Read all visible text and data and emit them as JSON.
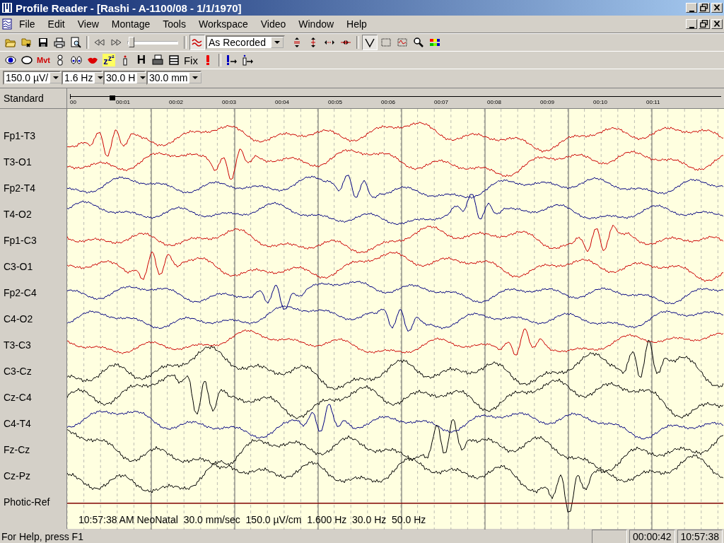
{
  "window": {
    "title": "Profile Reader - [Rashi - A-1100/08 - 1/1/1970]"
  },
  "menu": [
    "File",
    "Edit",
    "View",
    "Montage",
    "Tools",
    "Workspace",
    "Video",
    "Window",
    "Help"
  ],
  "toolbar1": {
    "slider": {
      "level": 0.08
    },
    "montage_combo": "As Recorded",
    "wave_toggle_on": true
  },
  "toolbar2": {
    "mvt_label": "Mvt",
    "sleep_label": "z$^{z²}$",
    "h_label": "H",
    "fix_label": "Fix"
  },
  "toolbar3": {
    "combos": [
      "150.0 µV/",
      "1.6 Hz",
      "30.0 H",
      "30.0 mm"
    ]
  },
  "timeline": {
    "montage": "Standard",
    "ticks": [
      "00",
      "00:01",
      "00:02",
      "00:03",
      "00:04",
      "00:05",
      "00:06",
      "00:07",
      "00:08",
      "00:09",
      "00:10",
      "00:11"
    ]
  },
  "channels": [
    {
      "name": "Fp1-T3",
      "color": "#cc0000"
    },
    {
      "name": "T3-O1",
      "color": "#cc0000"
    },
    {
      "name": "Fp2-T4",
      "color": "#000080"
    },
    {
      "name": "T4-O2",
      "color": "#000080"
    },
    {
      "name": "Fp1-C3",
      "color": "#cc0000"
    },
    {
      "name": "C3-O1",
      "color": "#cc0000"
    },
    {
      "name": "Fp2-C4",
      "color": "#000080"
    },
    {
      "name": "C4-O2",
      "color": "#000080"
    },
    {
      "name": "T3-C3",
      "color": "#cc0000"
    },
    {
      "name": "C3-Cz",
      "color": "#000000"
    },
    {
      "name": "Cz-C4",
      "color": "#000000"
    },
    {
      "name": "C4-T4",
      "color": "#000080"
    },
    {
      "name": "Fz-Cz",
      "color": "#000000"
    },
    {
      "name": "Cz-Pz",
      "color": "#000000"
    },
    {
      "name": "Photic-Ref",
      "color": "#800000"
    }
  ],
  "annotation": "10:57:38 AM NeoNatal  30.0 mm/sec  150.0 µV/cm  1.600 Hz  30.0 Hz  50.0 Hz",
  "status_bar": {
    "help": "For Help, press F1",
    "elapsed": "00:00:42",
    "clock": "10:57:38"
  }
}
